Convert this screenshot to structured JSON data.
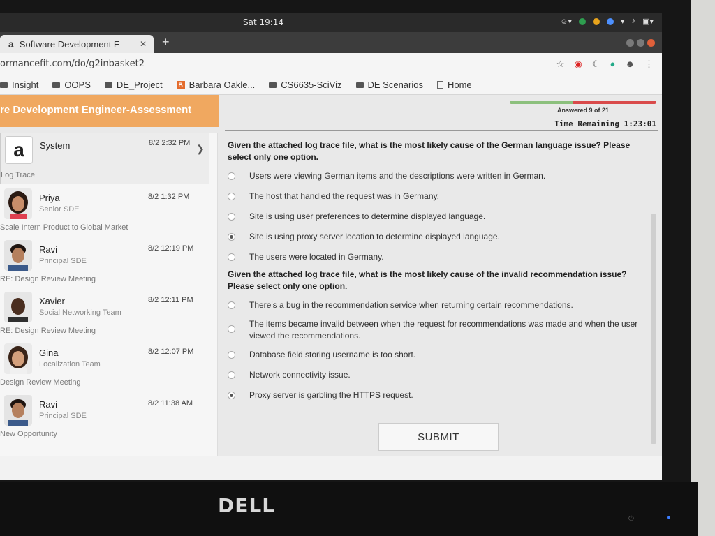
{
  "system": {
    "clock": "Sat 19:14"
  },
  "browser": {
    "tab_title": "Software Development E",
    "tab_favicon": "a",
    "url": "ormancefit.com/do/g2inbasket2",
    "bookmarks": [
      {
        "label": "Insight",
        "icon": "folder-icon"
      },
      {
        "label": "OOPS",
        "icon": "folder-icon"
      },
      {
        "label": "DE_Project",
        "icon": "folder-icon"
      },
      {
        "label": "Barbara Oakle...",
        "icon": "blogger-icon"
      },
      {
        "label": "CS6635-SciViz",
        "icon": "folder-icon"
      },
      {
        "label": "DE Scenarios",
        "icon": "folder-icon"
      },
      {
        "label": "Home",
        "icon": "page-icon"
      }
    ]
  },
  "app": {
    "banner_title": "re Development Engineer-Assessment",
    "progress_fraction": 0.43,
    "answered_text": "Answered 9 of 21",
    "time_remaining": "Time Remaining 1:23:01",
    "submit_label": "SUBMIT"
  },
  "inbox": [
    {
      "sender": "System",
      "role": "",
      "time": "8/2 2:32 PM",
      "subject": "Log Trace",
      "selected": true
    },
    {
      "sender": "Priya",
      "role": "Senior SDE",
      "time": "8/2 1:32 PM",
      "subject": "Scale Intern Product to Global Market"
    },
    {
      "sender": "Ravi",
      "role": "Principal SDE",
      "time": "8/2 12:19 PM",
      "subject": "RE: Design Review Meeting"
    },
    {
      "sender": "Xavier",
      "role": "Social Networking Team",
      "time": "8/2 12:11 PM",
      "subject": "RE: Design Review Meeting"
    },
    {
      "sender": "Gina",
      "role": "Localization Team",
      "time": "8/2 12:07 PM",
      "subject": "Design Review Meeting"
    },
    {
      "sender": "Ravi",
      "role": "Principal SDE",
      "time": "8/2 11:38 AM",
      "subject": "New Opportunity"
    }
  ],
  "questions": [
    {
      "text": "Given the attached log trace file, what is the most likely cause of the German language issue? Please select only one option.",
      "options": [
        "Users were viewing German items and the descriptions were written in German.",
        "The host that handled the request was in Germany.",
        "Site is using user preferences to determine displayed language.",
        "Site is using proxy server location to determine displayed language.",
        "The users were located in Germany."
      ],
      "selected": 3
    },
    {
      "text": "Given the attached log trace file, what is the most likely cause of the invalid recommendation issue? Please select only one option.",
      "options": [
        "There's a bug in the recommendation service when returning certain recommendations.",
        "The items became invalid between when the request for recommendations was made and when the user viewed the recommendations.",
        "Database field storing username is too short.",
        "Network connectivity issue.",
        "Proxy server is garbling the HTTPS request."
      ],
      "selected": 4
    }
  ],
  "monitor": {
    "brand": "DELL"
  }
}
